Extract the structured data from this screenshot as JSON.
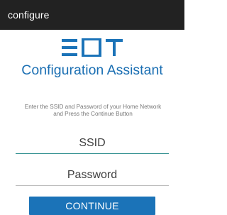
{
  "app": {
    "title": "configure"
  },
  "brand": {
    "logo_text": "EOT",
    "logo_color": "#1b73b8"
  },
  "main": {
    "heading": "Configuration Assistant",
    "instructions_line1": "Enter the SSID and Password of your Home Network",
    "instructions_line2": "and Press the Continue Button"
  },
  "form": {
    "ssid_placeholder": "SSID",
    "ssid_value": "",
    "password_placeholder": "Password",
    "password_value": "",
    "continue_label": "CONTINUE"
  },
  "colors": {
    "titlebar": "#222222",
    "accent": "#1b6fb3",
    "field_focus": "#2f8f8f"
  }
}
